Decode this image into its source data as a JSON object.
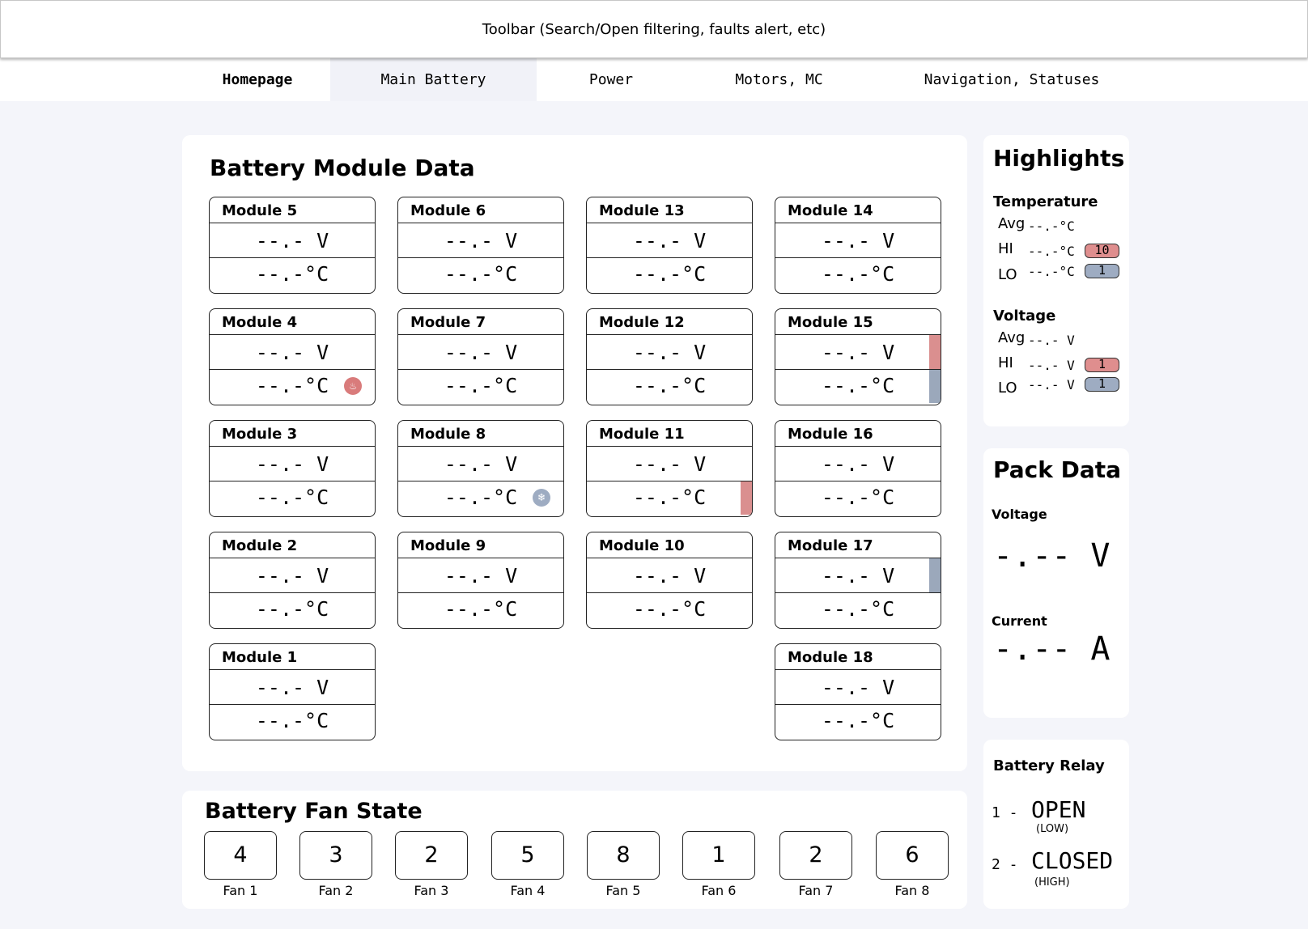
{
  "toolbar": {
    "text": "Toolbar (Search/Open filtering, faults alert, etc)"
  },
  "nav": {
    "tabs": [
      "Homepage",
      "Main Battery",
      "Power",
      "Motors, MC",
      "Navigation, Statuses"
    ]
  },
  "module_panel": {
    "title": "Battery Module Data",
    "modules": [
      {
        "name": "Module 5",
        "voltage": "--.- V",
        "temp": "--.-°C"
      },
      {
        "name": "Module 6",
        "voltage": "--.- V",
        "temp": "--.-°C"
      },
      {
        "name": "Module 13",
        "voltage": "--.- V",
        "temp": "--.-°C"
      },
      {
        "name": "Module 14",
        "voltage": "--.- V",
        "temp": "--.-°C"
      },
      {
        "name": "Module 4",
        "voltage": "--.- V",
        "temp": "--.-°C",
        "temp_icon": "flame-icon"
      },
      {
        "name": "Module 7",
        "voltage": "--.- V",
        "temp": "--.-°C"
      },
      {
        "name": "Module 12",
        "voltage": "--.- V",
        "temp": "--.-°C"
      },
      {
        "name": "Module 15",
        "voltage": "--.- V",
        "temp": "--.-°C",
        "voltage_flag": "high",
        "temp_flag": "low"
      },
      {
        "name": "Module 3",
        "voltage": "--.- V",
        "temp": "--.-°C"
      },
      {
        "name": "Module 8",
        "voltage": "--.- V",
        "temp": "--.-°C",
        "temp_icon": "snowflake-icon"
      },
      {
        "name": "Module 11",
        "voltage": "--.- V",
        "temp": "--.-°C",
        "temp_flag": "high"
      },
      {
        "name": "Module 16",
        "voltage": "--.- V",
        "temp": "--.-°C"
      },
      {
        "name": "Module 2",
        "voltage": "--.- V",
        "temp": "--.-°C"
      },
      {
        "name": "Module 9",
        "voltage": "--.- V",
        "temp": "--.-°C"
      },
      {
        "name": "Module 10",
        "voltage": "--.- V",
        "temp": "--.-°C"
      },
      {
        "name": "Module 17",
        "voltage": "--.- V",
        "temp": "--.-°C",
        "voltage_flag": "low"
      },
      {
        "name": "Module 1",
        "voltage": "--.- V",
        "temp": "--.-°C"
      },
      {
        "name": "Module 18",
        "voltage": "--.- V",
        "temp": "--.-°C"
      }
    ]
  },
  "fan_panel": {
    "title": "Battery Fan State",
    "fans": [
      {
        "label": "Fan 1",
        "value": "4"
      },
      {
        "label": "Fan 2",
        "value": "3"
      },
      {
        "label": "Fan 3",
        "value": "2"
      },
      {
        "label": "Fan 4",
        "value": "5"
      },
      {
        "label": "Fan 5",
        "value": "8"
      },
      {
        "label": "Fan 6",
        "value": "1"
      },
      {
        "label": "Fan 7",
        "value": "2"
      },
      {
        "label": "Fan 8",
        "value": "6"
      }
    ]
  },
  "highlights": {
    "title": "Highlights",
    "temperature": {
      "label": "Temperature",
      "avg_label": "Avg",
      "avg": "--.-°C",
      "hi_label": "HI",
      "hi": "--.-°C",
      "hi_module": "10",
      "lo_label": "LO",
      "lo": "--.-°C",
      "lo_module": "1"
    },
    "voltage": {
      "label": "Voltage",
      "avg_label": "Avg",
      "avg": "--.- V",
      "hi_label": "HI",
      "hi": "--.- V",
      "hi_module": "1",
      "lo_label": "LO",
      "lo": "--.- V",
      "lo_module": "1"
    }
  },
  "pack": {
    "title": "Pack Data",
    "voltage_label": "Voltage",
    "voltage": "-.-- V",
    "current_label": "Current",
    "current": "-.-- A"
  },
  "relay": {
    "title": "Battery Relay",
    "items": [
      {
        "index": "1 -",
        "state": "OPEN",
        "level": "(LOW)"
      },
      {
        "index": "2 -",
        "state": "CLOSED",
        "level": "(HIGH)"
      }
    ]
  },
  "colors": {
    "hot": "#da8f8f",
    "cold": "#9ba8bb",
    "background": "#f4f5fa"
  }
}
